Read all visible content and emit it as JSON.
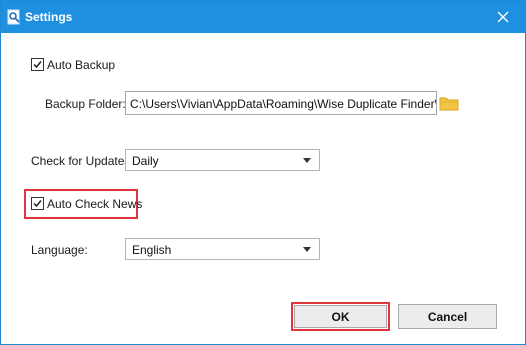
{
  "window": {
    "title": "Settings",
    "close_icon": "close-icon",
    "app_icon": "settings-app-icon"
  },
  "backup": {
    "auto_backup_label": "Auto Backup",
    "auto_backup_checked": true,
    "folder_label": "Backup Folder:",
    "folder_value": "C:\\Users\\Vivian\\AppData\\Roaming\\Wise Duplicate Finder\\",
    "browse_icon": "folder-icon"
  },
  "updates": {
    "label": "Check for Updates:",
    "selected": "Daily"
  },
  "news": {
    "label": "Auto Check News",
    "checked": true
  },
  "language": {
    "label": "Language:",
    "selected": "English"
  },
  "buttons": {
    "ok": "OK",
    "cancel": "Cancel"
  },
  "colors": {
    "titlebar": "#1f8fe0",
    "highlight": "#e0353a"
  }
}
